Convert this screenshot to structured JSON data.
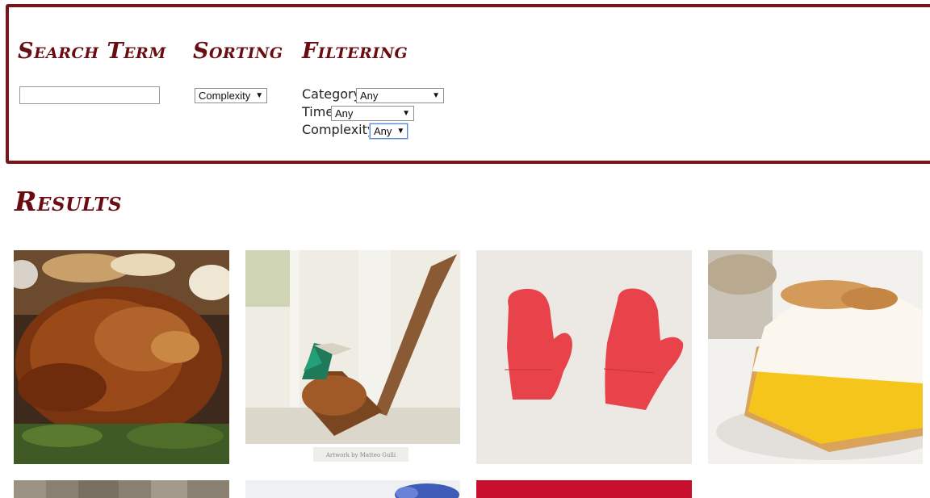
{
  "panel": {
    "search": {
      "heading": "Search Term",
      "value": "",
      "placeholder": ""
    },
    "sorting": {
      "heading": "Sorting",
      "selected": "Complexity"
    },
    "filtering": {
      "heading": "Filtering",
      "filters": [
        {
          "label": "Category",
          "selected": "Any"
        },
        {
          "label": "Time",
          "selected": "Any"
        },
        {
          "label": "Complexity",
          "selected": "Any"
        }
      ]
    }
  },
  "results": {
    "heading": "Results",
    "items": [
      {
        "icon": "roast-turkey-image"
      },
      {
        "icon": "origami-pheasant-image",
        "caption": "Artwork by Matteo Gulli"
      },
      {
        "icon": "felt-mittens-image"
      },
      {
        "icon": "lemon-meringue-pie-image"
      },
      {
        "icon": "wood-planks-image"
      },
      {
        "icon": "blue-flower-image"
      },
      {
        "icon": "red-fabric-image"
      }
    ]
  },
  "colors": {
    "accent": "#7a1418",
    "heading": "#6a0d12"
  }
}
